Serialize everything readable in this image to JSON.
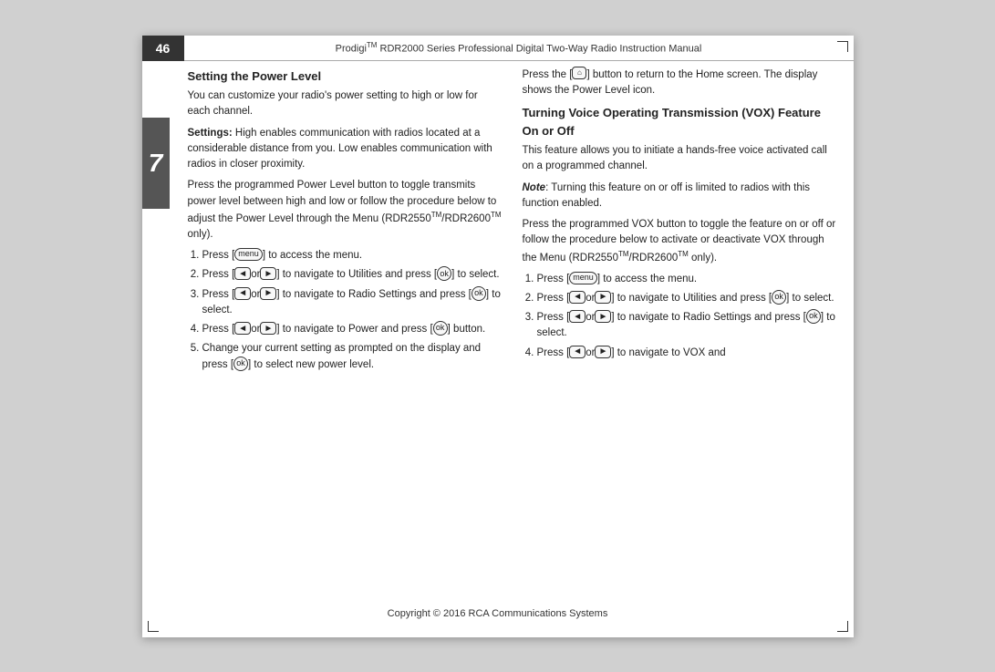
{
  "page": {
    "number": "46",
    "chapter": "7",
    "header": "ProdigiTM RDR2000 Series Professional Digital Two-Way Radio Instruction Manual",
    "footer": "Copyright © 2016 RCA Communications Systems"
  },
  "left_column": {
    "title": "Setting the Power Level",
    "intro": "You can customize your radio's power setting to high or low for each channel.",
    "settings_label": "Settings:",
    "settings_text": "High enables communication with radios located at a considerable distance from you. Low enables communication with radios in closer proximity.",
    "body1": "Press the programmed Power Level button to toggle transmits power level between high and low or follow the procedure below to adjust the Power Level through the Menu (RDR2550TM/RDR2600TM only).",
    "steps": [
      "Press [menu] to access the menu.",
      "Press [◄or►] to navigate to Utilities and press [ok] to select.",
      "Press [◄or►] to navigate to Radio Settings and press [ok] to select.",
      "Press [◄or►] to navigate to Power and press [ok] button.",
      "Change your current setting as prompted on the display and press [ok] to select new power level."
    ]
  },
  "right_column": {
    "body1": "Press the [back] button to return to the Home screen. The display shows the Power Level icon.",
    "title2": "Turning Voice Operating Transmission (VOX) Feature On or Off",
    "body2": "This feature allows you to initiate a hands-free voice activated call on a programmed channel.",
    "note_label": "Note",
    "note_text": ": Turning this feature on or off is limited to radios with this function enabled.",
    "body3": "Press the programmed VOX button to toggle the feature on or off or follow the procedure below to activate or deactivate VOX through the Menu (RDR2550TM/RDR2600TM only).",
    "steps": [
      "Press [menu] to access the menu.",
      "Press [◄or►] to navigate to Utilities and press [ok] to select.",
      "Press [◄or►] to navigate to Radio Settings and press [ok] to select.",
      "Press [◄or►] to navigate to VOX and"
    ]
  }
}
